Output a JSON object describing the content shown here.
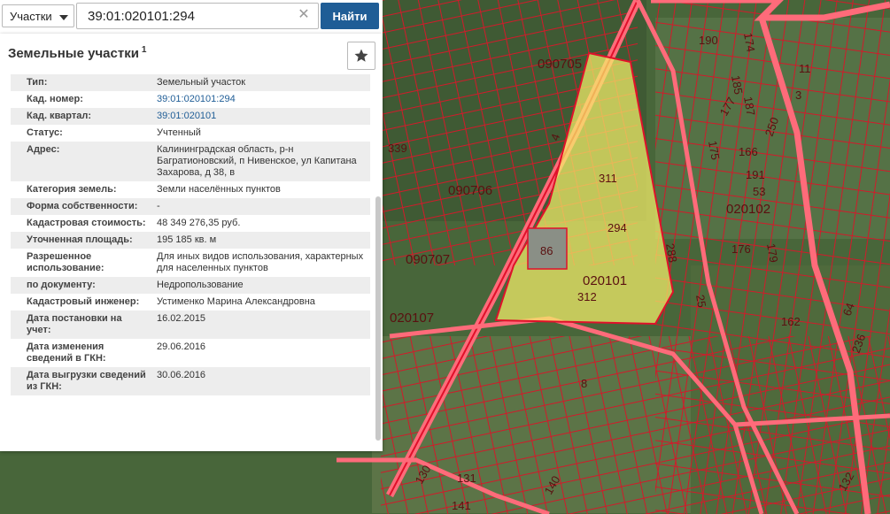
{
  "search": {
    "type_label": "Участки",
    "query": "39:01:020101:294",
    "clear_icon": "close-icon",
    "button_label": "Найти"
  },
  "panel": {
    "title": "Земельные участки",
    "title_index": "1",
    "favorite_icon": "star-icon",
    "attributes": [
      {
        "key": "Тип:",
        "value": "Земельный участок"
      },
      {
        "key": "Кад. номер:",
        "value": "39:01:020101:294",
        "link": true
      },
      {
        "key": "Кад. квартал:",
        "value": "39:01:020101",
        "link": true
      },
      {
        "key": "Статус:",
        "value": "Учтенный"
      },
      {
        "key": "Адрес:",
        "value": "Калининградская область, р-н Багратионовский, п Нивенское, ул Капитана Захарова, д 38, в"
      },
      {
        "key": "Категория земель:",
        "value": "Земли населённых пунктов"
      },
      {
        "key": "Форма собственности:",
        "value": "-"
      },
      {
        "key": "Кадастровая стоимость:",
        "value": "48 349 276,35 руб."
      },
      {
        "key": "Уточненная площадь:",
        "value": "195 185 кв. м"
      },
      {
        "key": "Разрешенное использование:",
        "value": "Для иных видов использования, характерных для населенных пунктов"
      },
      {
        "key": "по документу:",
        "value": "Недропользование"
      },
      {
        "key": "Кадастровый инженер:",
        "value": "Устименко Марина Александровна"
      },
      {
        "key": "Дата постановки на учет:",
        "value": "16.02.2015"
      },
      {
        "key": "Дата изменения сведений в ГКН:",
        "value": "29.06.2016"
      },
      {
        "key": "Дата выгрузки сведений из ГКН:",
        "value": "30.06.2016"
      }
    ]
  },
  "map": {
    "labels": [
      "090705",
      "090706",
      "090707",
      "020107",
      "020101",
      "020102",
      "311",
      "294",
      "86",
      "312",
      "339",
      "4",
      "190",
      "174",
      "11",
      "3",
      "185",
      "187",
      "177",
      "175",
      "250",
      "166",
      "191",
      "53",
      "179",
      "176",
      "288",
      "25",
      "162",
      "64",
      "236",
      "8",
      "130",
      "131",
      "140",
      "141",
      "132"
    ],
    "colors": {
      "parcel_outline": "#e0102a",
      "selected_fill": "#f5f06a",
      "road": "#ff5a6a"
    }
  }
}
